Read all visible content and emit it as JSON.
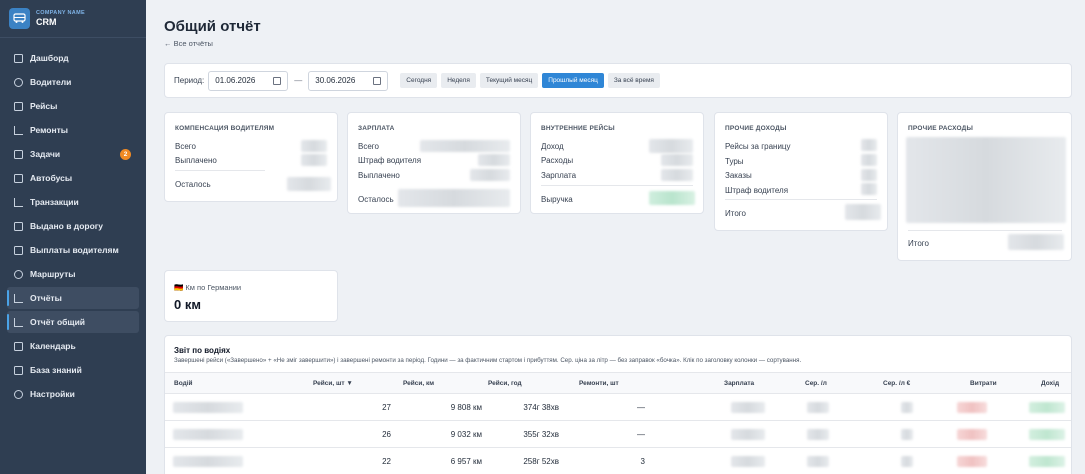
{
  "brand": {
    "company": "COMPANY NAME",
    "app": "CRM"
  },
  "sidebar": {
    "items": [
      {
        "label": "Дашборд",
        "icon": "dashboard-icon"
      },
      {
        "label": "Водители",
        "icon": "users-icon"
      },
      {
        "label": "Рейсы",
        "icon": "document-icon"
      },
      {
        "label": "Ремонты",
        "icon": "wrench-icon"
      },
      {
        "label": "Задачи",
        "icon": "tasks-icon",
        "badge": "2"
      },
      {
        "label": "Автобусы",
        "icon": "bus-icon"
      },
      {
        "label": "Транзакции",
        "icon": "transactions-icon"
      },
      {
        "label": "Выдано в дорогу",
        "icon": "wallet-icon"
      },
      {
        "label": "Выплаты водителям",
        "icon": "payments-icon"
      },
      {
        "label": "Маршруты",
        "icon": "route-icon"
      },
      {
        "label": "Отчёты",
        "icon": "chart-icon"
      },
      {
        "label": "Отчёт общий",
        "icon": "chart-icon"
      },
      {
        "label": "Календарь",
        "icon": "calendar-icon"
      },
      {
        "label": "База знаний",
        "icon": "book-icon"
      },
      {
        "label": "Настройки",
        "icon": "gear-icon"
      }
    ],
    "active_index": 11,
    "highlight_index": 10
  },
  "header": {
    "title": "Общий отчёт",
    "back": "← Все отчёты"
  },
  "period": {
    "label": "Период:",
    "from": "01.06.2026",
    "to": "30.06.2026",
    "separator": "—",
    "buttons": [
      "Сегодня",
      "Неделя",
      "Текущий месяц",
      "Прошлый месяц",
      "За всё время"
    ],
    "selected": "Прошлый месяц"
  },
  "cards": {
    "compensation": {
      "title": "Компенсация водителям",
      "rows": [
        "Всего",
        "Выплачено"
      ],
      "remaining": "Осталось"
    },
    "salary": {
      "title": "Зарплата",
      "rows": [
        "Всего",
        "Штраф водителя",
        "Выплачено"
      ],
      "remaining": "Осталось"
    },
    "internal": {
      "title": "Внутренние рейсы",
      "rows": [
        "Доход",
        "Расходы",
        "Зарплата"
      ],
      "total": "Выручка"
    },
    "other_income": {
      "title": "Прочие доходы",
      "rows": [
        "Рейсы за границу",
        "Туры",
        "Заказы",
        "Штраф водителя"
      ],
      "total": "Итого"
    },
    "other_expenses": {
      "title": "Прочие расходы",
      "total": "Итого"
    }
  },
  "km": {
    "label": "🇩🇪 Км по Германии",
    "value": "0 км"
  },
  "table": {
    "title": "Звіт по водіях",
    "subtitle": "Завершені рейси («Завершено» + «Не зміг завершити») і завершені ремонти за період. Години — за фактичним стартом і прибуттям. Сер. ціна за літр — без заправок «бочка». Клік по заголовку колонки — сортування.",
    "columns": [
      "Водій",
      "Рейси, шт ▼",
      "Рейси, км",
      "Рейси, год",
      "Ремонти, шт",
      "Зарплата",
      "Сер. /л",
      "Сер. /л €",
      "Витрати",
      "Дохід"
    ],
    "rows": [
      {
        "trips": "27",
        "km": "9 808 км",
        "hours": "374г 38хв",
        "repairs": "—"
      },
      {
        "trips": "26",
        "km": "9 032 км",
        "hours": "355г 32хв",
        "repairs": "—"
      },
      {
        "trips": "22",
        "km": "6 957 км",
        "hours": "258г 52хв",
        "repairs": "3"
      }
    ]
  }
}
